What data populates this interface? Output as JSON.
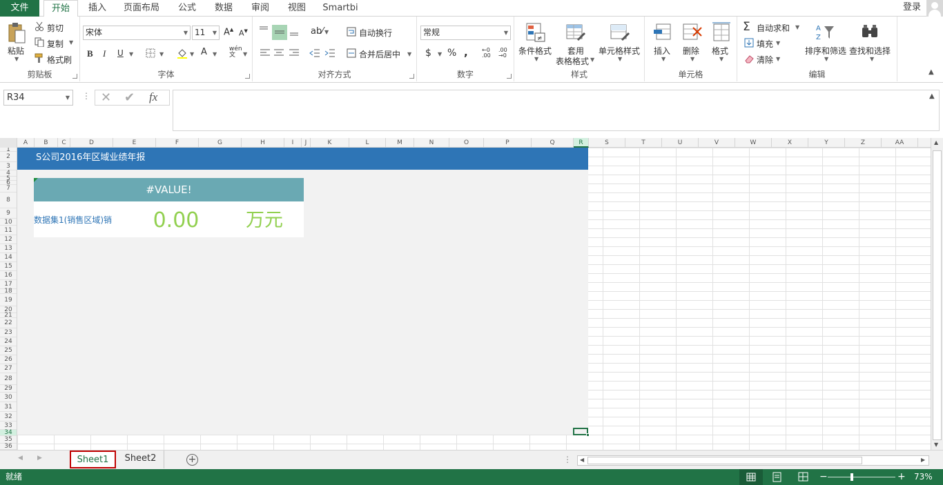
{
  "tabs": {
    "file": "文件",
    "items": [
      "开始",
      "插入",
      "页面布局",
      "公式",
      "数据",
      "审阅",
      "视图",
      "Smartbi"
    ],
    "active_index": 0,
    "login": "登录"
  },
  "ribbon": {
    "clipboard": {
      "paste": "粘贴",
      "cut": "剪切",
      "copy": "复制",
      "format_painter": "格式刷",
      "label": "剪贴板"
    },
    "font": {
      "name": "宋体",
      "size": "11",
      "label": "字体"
    },
    "alignment": {
      "wrap": "自动换行",
      "merge": "合并后居中",
      "label": "对齐方式"
    },
    "number": {
      "format": "常规",
      "label": "数字"
    },
    "styles": {
      "conditional": "条件格式",
      "table1": "套用",
      "table2": "表格格式",
      "cell_styles": "单元格样式",
      "label": "样式"
    },
    "cells": {
      "insert": "插入",
      "delete": "删除",
      "format": "格式",
      "label": "单元格"
    },
    "editing": {
      "autosum": "自动求和",
      "fill": "填充",
      "clear": "清除",
      "sort": "排序和筛选",
      "find": "查找和选择",
      "label": "编辑"
    }
  },
  "formula_bar": {
    "name_box": "R34",
    "formula": "",
    "fx": "fx"
  },
  "columns": [
    "A",
    "B",
    "C",
    "D",
    "E",
    "F",
    "G",
    "H",
    "I",
    "J",
    "K",
    "L",
    "M",
    "N",
    "O",
    "P",
    "Q",
    "R",
    "S",
    "T",
    "U",
    "V",
    "W",
    "X",
    "Y",
    "Z",
    "AA"
  ],
  "selected_column": "R",
  "rows": [
    "1",
    "2",
    "3",
    "4",
    "5",
    "6",
    "7",
    "8",
    "9",
    "10",
    "11",
    "12",
    "13",
    "14",
    "15",
    "16",
    "17",
    "18",
    "19",
    "20",
    "21",
    "22",
    "23",
    "24",
    "25",
    "26",
    "27",
    "28",
    "29",
    "30",
    "31",
    "32",
    "33",
    "34",
    "35",
    "36"
  ],
  "report": {
    "title": "S公司2016年区域业绩年报",
    "card_header": "#VALUE!",
    "card_label": "数据集1(销售区域)销",
    "card_value": "0.00",
    "card_unit": "万元"
  },
  "sheets": [
    "Sheet1",
    "Sheet2"
  ],
  "active_sheet": "Sheet1",
  "status": {
    "text": "就绪",
    "zoom": "73%"
  },
  "colors": {
    "excel_green": "#217346",
    "title_blue": "#2e75b6",
    "card_teal": "#6aa9b3",
    "value_green": "#92d050"
  }
}
